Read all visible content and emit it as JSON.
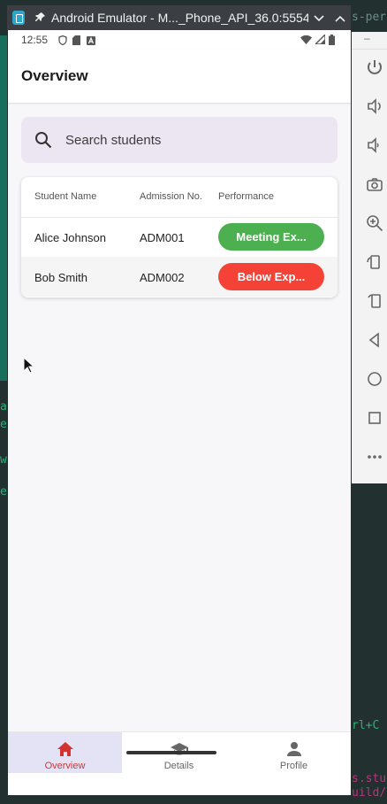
{
  "window": {
    "title": "Android Emulator - M..._Phone_API_36.0:5554"
  },
  "status_bar": {
    "time": "12:55"
  },
  "app_bar": {
    "title": "Overview"
  },
  "search": {
    "placeholder": "Search students"
  },
  "table": {
    "headers": [
      "Student Name",
      "Admission No.",
      "Performance"
    ],
    "rows": [
      {
        "name": "Alice Johnson",
        "admission": "ADM001",
        "performance": "Meeting Ex...",
        "color": "#4caf50"
      },
      {
        "name": "Bob Smith",
        "admission": "ADM002",
        "performance": "Below Exp...",
        "color": "#f44336"
      }
    ]
  },
  "bottom_nav": {
    "items": [
      {
        "label": "Overview",
        "icon": "home-icon",
        "active": true
      },
      {
        "label": "Details",
        "icon": "school-icon",
        "active": false
      },
      {
        "label": "Profile",
        "icon": "person-icon",
        "active": false
      }
    ]
  },
  "colors": {
    "accent": "#d3332f",
    "nav_active_bg": "#e4e3f6",
    "search_bg": "#ece6f2"
  }
}
